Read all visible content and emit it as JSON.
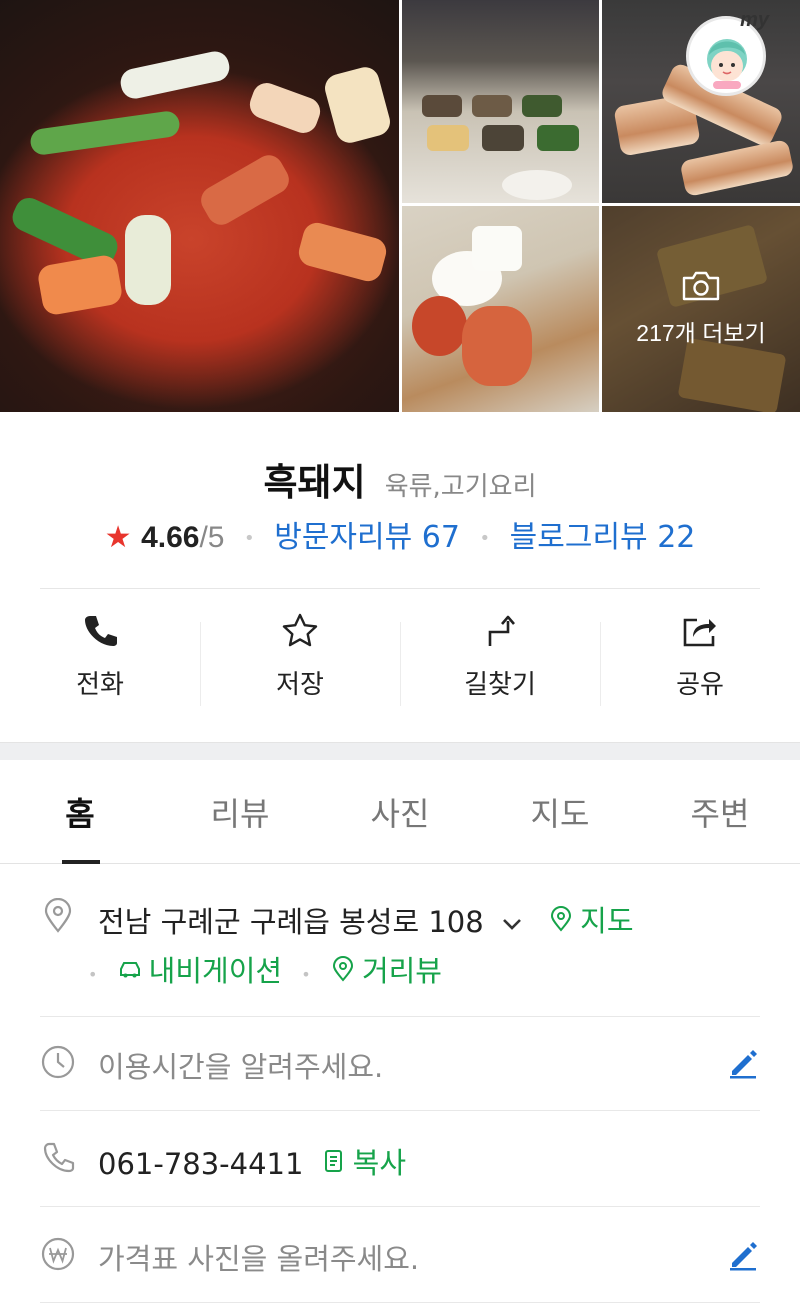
{
  "gallery": {
    "more_label": "217개 더보기",
    "my_label": "my"
  },
  "place": {
    "name": "흑돼지",
    "category": "육류,고기요리",
    "rating_star": "★",
    "rating_value": "4.66",
    "rating_max": "/5",
    "visitor_reviews_label": "방문자리뷰 67",
    "blog_reviews_label": "블로그리뷰 22"
  },
  "actions": {
    "call_label": "전화",
    "save_label": "저장",
    "directions_label": "길찾기",
    "share_label": "공유"
  },
  "tabs": [
    {
      "label": "홈",
      "active": true
    },
    {
      "label": "리뷰",
      "active": false
    },
    {
      "label": "사진",
      "active": false
    },
    {
      "label": "지도",
      "active": false
    },
    {
      "label": "주변",
      "active": false
    }
  ],
  "details": {
    "address": "전남 구례군 구례읍 봉성로 108",
    "map_link": "지도",
    "navigation_link": "내비게이션",
    "street_view_link": "거리뷰",
    "hours_placeholder": "이용시간을 알려주세요.",
    "phone": "061-783-4411",
    "copy_label": "복사",
    "price_placeholder": "가격표 사진을 올려주세요."
  },
  "colors": {
    "link_blue": "#1f6fcf",
    "link_green": "#16a34a",
    "star_red": "#e8352d",
    "edit_blue": "#1f6fcf"
  }
}
